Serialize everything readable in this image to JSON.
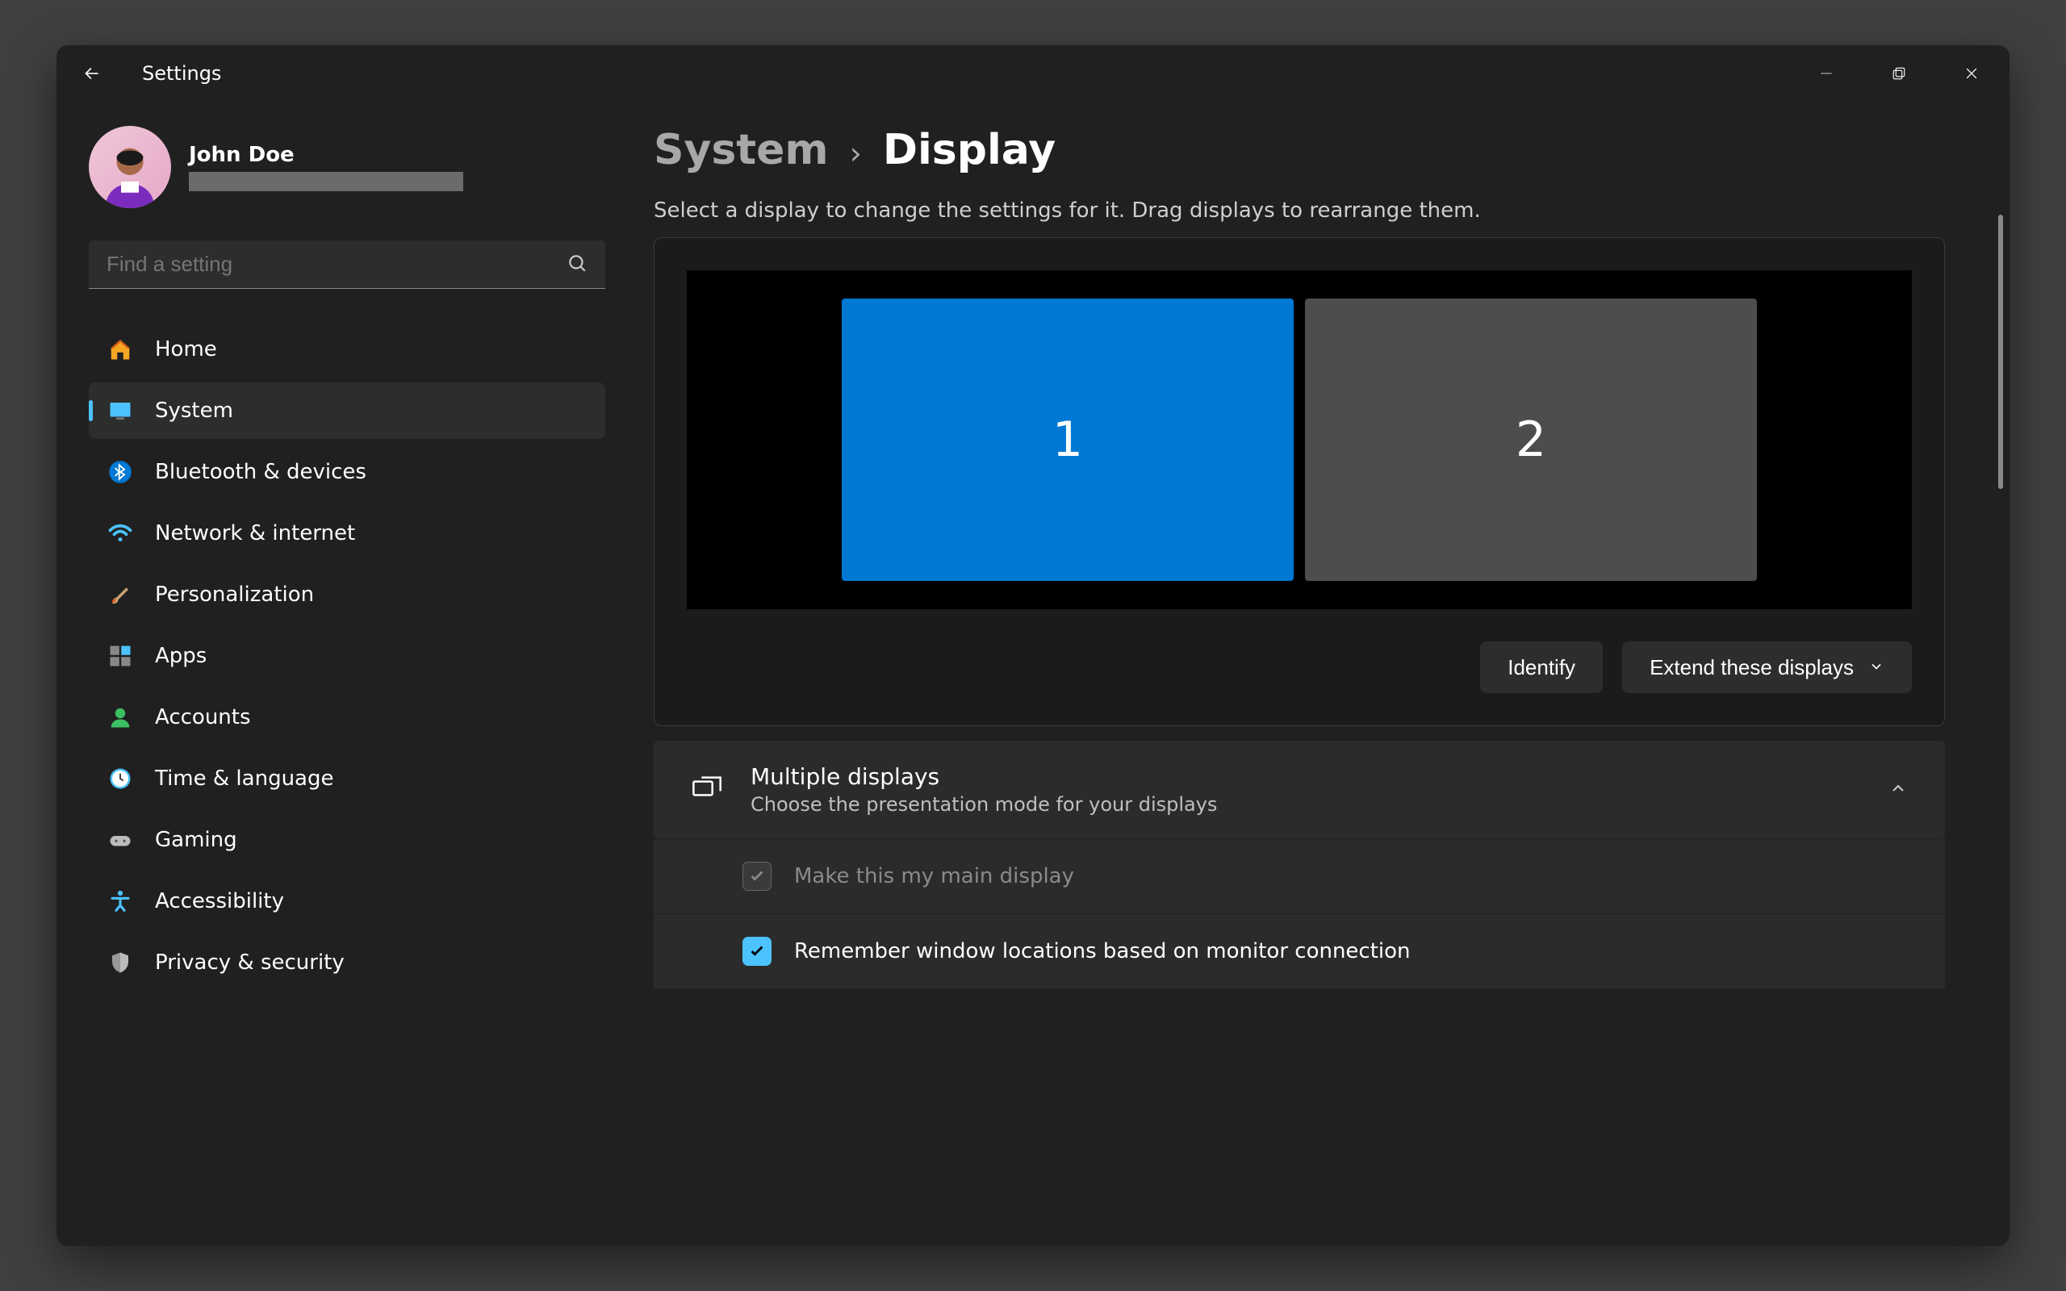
{
  "window": {
    "title": "Settings"
  },
  "profile": {
    "name": "John Doe"
  },
  "search": {
    "placeholder": "Find a setting"
  },
  "nav": {
    "items": [
      {
        "label": "Home"
      },
      {
        "label": "System"
      },
      {
        "label": "Bluetooth & devices"
      },
      {
        "label": "Network & internet"
      },
      {
        "label": "Personalization"
      },
      {
        "label": "Apps"
      },
      {
        "label": "Accounts"
      },
      {
        "label": "Time & language"
      },
      {
        "label": "Gaming"
      },
      {
        "label": "Accessibility"
      },
      {
        "label": "Privacy & security"
      }
    ],
    "activeIndex": 1
  },
  "breadcrumb": {
    "parent": "System",
    "current": "Display"
  },
  "subtitle": "Select a display to change the settings for it. Drag displays to rearrange them.",
  "monitors": [
    {
      "num": "1",
      "selected": true
    },
    {
      "num": "2",
      "selected": false
    }
  ],
  "actions": {
    "identify": "Identify",
    "extend": "Extend these displays"
  },
  "multipleDisplays": {
    "title": "Multiple displays",
    "desc": "Choose the presentation mode for your displays",
    "makeMain": "Make this my main display",
    "remember": "Remember window locations based on monitor connection"
  }
}
